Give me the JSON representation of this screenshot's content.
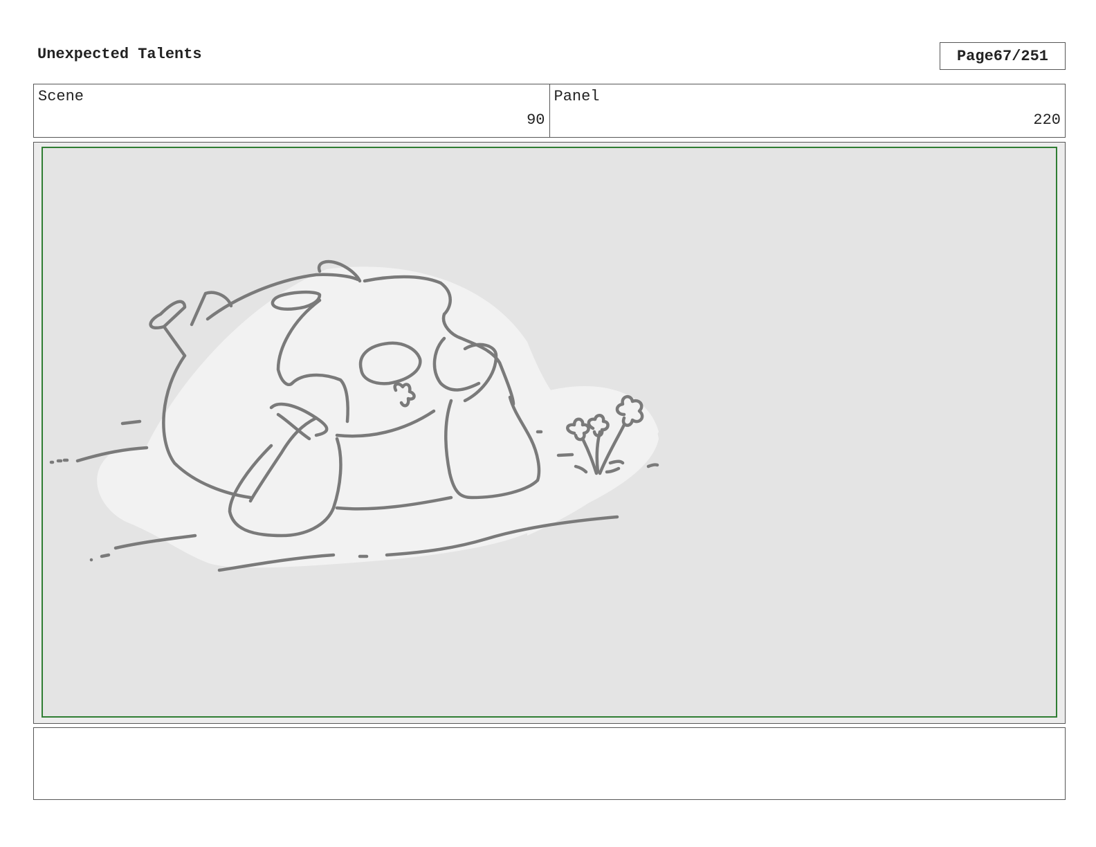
{
  "header": {
    "title": "Unexpected Talents",
    "page_label": "Page",
    "page_number": "67/251"
  },
  "info": {
    "scene_label": "Scene",
    "scene_value": "90",
    "panel_label": "Panel",
    "panel_value": "220"
  },
  "frame": {
    "frame_border_color": "#2f7d32",
    "sketch_line_color": "#7a7a7a",
    "drawing": "character-lying-on-ground-with-flowers"
  },
  "notes": {
    "text": ""
  }
}
